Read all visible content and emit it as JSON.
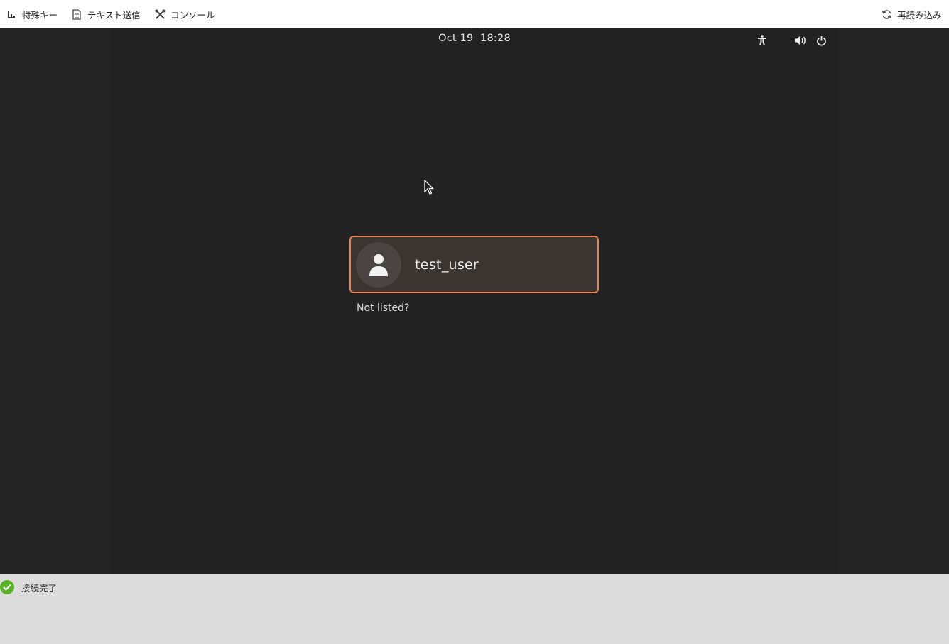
{
  "toolbar": {
    "special_keys": "特殊キー",
    "send_text": "テキスト送信",
    "console": "コンソール",
    "reload": "再読み込み"
  },
  "topbar": {
    "date": "Oct 19",
    "time": "18:28",
    "icons": [
      "accessibility-icon",
      "volume-icon",
      "power-icon"
    ]
  },
  "login": {
    "username": "test_user",
    "not_listed": "Not listed?",
    "accent_color": "#e8825a"
  },
  "status": {
    "text": "接続完了",
    "color": "#59b327"
  }
}
